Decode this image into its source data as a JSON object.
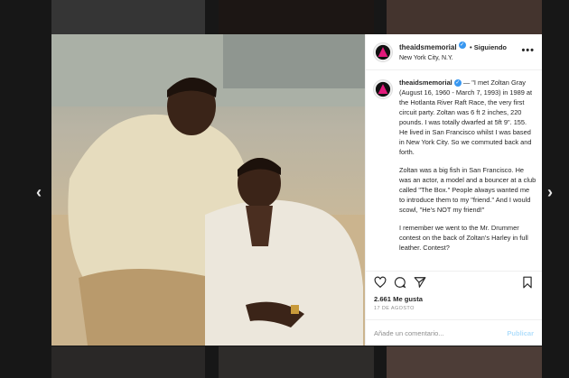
{
  "post": {
    "username": "theaidsmemorial",
    "follow_label": "Siguiendo",
    "location": "New York City, N.Y.",
    "more_label": "•••",
    "caption_paragraphs": [
      "— \"I met Zoltan Gray (August 16, 1960 - March 7, 1993) in 1989 at the Hotlanta River Raft Race, the very first circuit party. Zoltan was 6 ft 2 inches, 220 pounds. I was totally dwarfed at 5ft 9\". 155. He lived in San Francisco whilst I was based in New York City. So we commuted back and forth.",
      "Zoltan was a big fish in San Francisco. He was an actor, a model and a bouncer at a club called \"The Box.\" People always wanted me to introduce them to my \"friend.\" And I would scowl, \"He's NOT my friend!\"",
      "I remember we went to the Mr. Drummer contest on the back of Zoltan's Harley in full leather. Contest?"
    ],
    "likes": "2.661 Me gusta",
    "date": "17 DE AGOSTO",
    "comment_placeholder": "Añade un comentario...",
    "publish_label": "Publicar",
    "prev_label": "‹",
    "next_label": "›"
  },
  "icons": {
    "heart": "heart-icon",
    "comment": "comment-icon",
    "share": "share-icon",
    "save": "bookmark-icon"
  },
  "colors": {
    "link_blue": "#3897f0",
    "publish_disabled": "#b2dffc",
    "text": "#262626",
    "muted": "#8e8e8e"
  }
}
